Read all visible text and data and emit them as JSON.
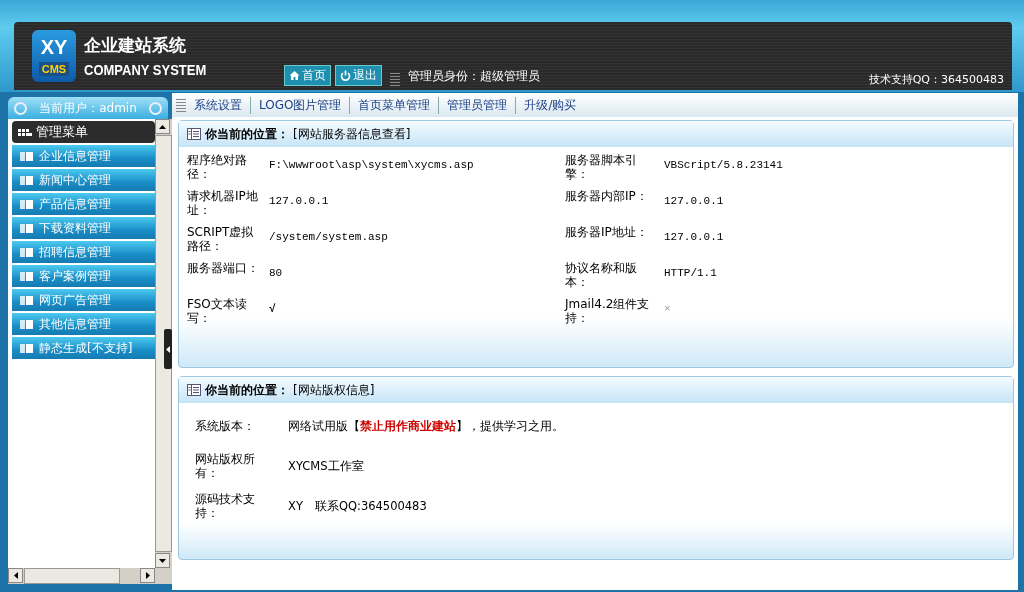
{
  "header": {
    "logo": {
      "mark_top": "XY",
      "mark_bottom": "CMS",
      "title": "企业建站系统",
      "subtitle": "COMPANY SYSTEM"
    },
    "buttons": [
      {
        "label": "首页",
        "kind": "home"
      },
      {
        "label": "退出",
        "kind": "power"
      }
    ],
    "admin_role": "管理员身份：超级管理员",
    "support": "技术支持QQ：364500483"
  },
  "user_tab": "当前用户：admin",
  "nav": [
    "系统设置",
    "LOGO图片管理",
    "首页菜单管理",
    "管理员管理",
    "升级/购买"
  ],
  "sidebar": {
    "title": "管理菜单",
    "items": [
      "企业信息管理",
      "新闻中心管理",
      "产品信息管理",
      "下载资料管理",
      "招聘信息管理",
      "客户案例管理",
      "网页广告管理",
      "其他信息管理",
      "静态生成[不支持]"
    ]
  },
  "panels": [
    {
      "kind": "grid",
      "location_label": "你当前的位置：",
      "location": "[网站服务器信息查看]",
      "fields": [
        {
          "label": "程序绝对路径：",
          "value": "F:\\wwwroot\\asp\\system\\xycms.asp"
        },
        {
          "label": "服务器脚本引擎：",
          "value": "VBScript/5.8.23141"
        },
        {
          "label": "请求机器IP地址：",
          "value": "127.0.0.1"
        },
        {
          "label": "服务器内部IP：",
          "value": "127.0.0.1"
        },
        {
          "label": "SCRIPT虚拟路径：",
          "value": "/system/system.asp"
        },
        {
          "label": "服务器IP地址：",
          "value": "127.0.0.1"
        },
        {
          "label": "服务器端口：",
          "value": "80"
        },
        {
          "label": "协议名称和版本：",
          "value": "HTTP/1.1"
        },
        {
          "label": "FSO文本读写：",
          "value": "√",
          "kind": "yes"
        },
        {
          "label": "Jmail4.2组件支持：",
          "value": "×",
          "kind": "no"
        }
      ]
    },
    {
      "kind": "list",
      "location_label": "你当前的位置：",
      "location": "[网站版权信息]",
      "fields": [
        {
          "label": "系统版本：",
          "value": "网络试用版【**禁止用作商业建站**】，提供学习之用。"
        },
        {
          "label": "网站版权所有：",
          "value": "XYCMS工作室"
        },
        {
          "label": "源码技术支持：",
          "value": "XY　联系QQ:364500483"
        }
      ]
    }
  ]
}
